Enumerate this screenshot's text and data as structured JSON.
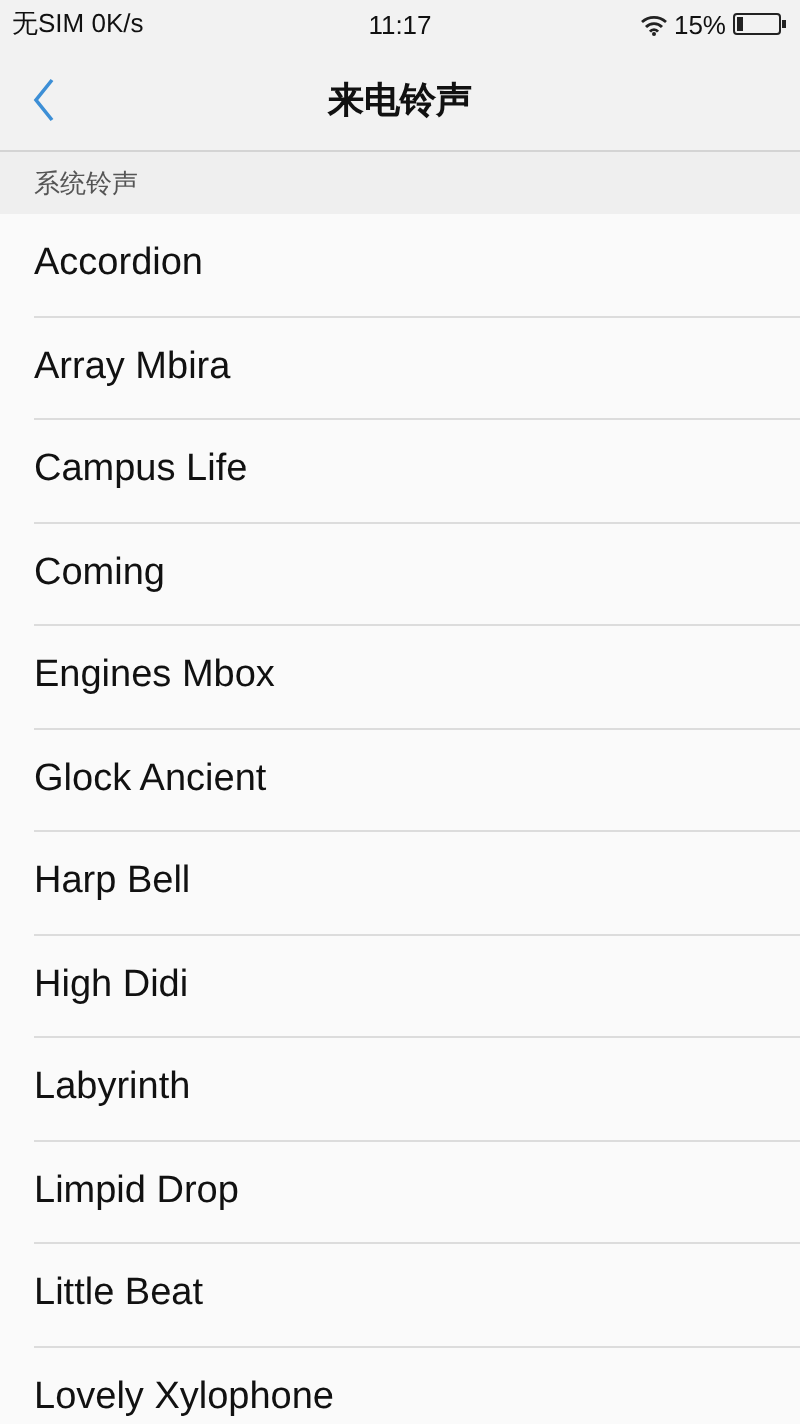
{
  "status_bar": {
    "carrier": "无SIM 0K/s",
    "time": "11:17",
    "battery": "15%"
  },
  "nav": {
    "title": "来电铃声"
  },
  "section": {
    "title": "系统铃声"
  },
  "ringtones": [
    {
      "name": "Accordion"
    },
    {
      "name": "Array Mbira"
    },
    {
      "name": "Campus Life"
    },
    {
      "name": "Coming"
    },
    {
      "name": "Engines Mbox"
    },
    {
      "name": "Glock Ancient"
    },
    {
      "name": "Harp Bell"
    },
    {
      "name": "High Didi"
    },
    {
      "name": "Labyrinth"
    },
    {
      "name": "Limpid Drop"
    },
    {
      "name": "Little Beat"
    },
    {
      "name": "Lovely Xylophone"
    }
  ]
}
